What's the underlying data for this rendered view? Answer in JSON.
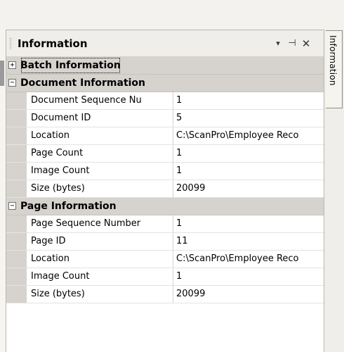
{
  "panel": {
    "title": "Information",
    "buttons": {
      "dropdown": "▾",
      "pin": "⊣",
      "close": "✕"
    }
  },
  "side_tab": {
    "label": "Information"
  },
  "categories": [
    {
      "label": "Batch Information",
      "expander": "+",
      "rows": []
    },
    {
      "label": "Document Information",
      "expander": "−",
      "rows": [
        {
          "name": "Document Sequence Nu",
          "value": "1"
        },
        {
          "name": "Document ID",
          "value": "5"
        },
        {
          "name": "Location",
          "value": "C:\\ScanPro\\Employee Reco"
        },
        {
          "name": "Page Count",
          "value": "1"
        },
        {
          "name": "Image Count",
          "value": "1"
        },
        {
          "name": "Size (bytes)",
          "value": "20099"
        }
      ]
    },
    {
      "label": "Page Information",
      "expander": "−",
      "rows": [
        {
          "name": "Page Sequence Number",
          "value": "1"
        },
        {
          "name": "Page ID",
          "value": "11"
        },
        {
          "name": "Location",
          "value": "C:\\ScanPro\\Employee Reco"
        },
        {
          "name": "Image Count",
          "value": "1"
        },
        {
          "name": "Size (bytes)",
          "value": "20099"
        }
      ]
    }
  ]
}
